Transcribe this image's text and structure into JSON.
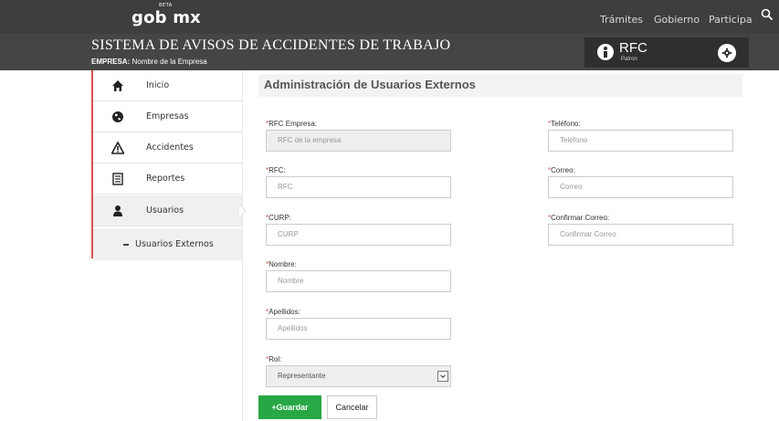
{
  "topbar": {
    "logo": "gob",
    "logo_mx": "mx",
    "beta": "BETA",
    "links": [
      "Trámites",
      "Gobierno",
      "Participa"
    ]
  },
  "header": {
    "title": "SISTEMA DE AVISOS DE ACCIDENTES DE TRABAJO",
    "company_label": "EMPRESA:",
    "company_value": "Nombre de la Empresa",
    "rfc_label": "RFC",
    "rfc_sub": "Patron"
  },
  "sidebar": {
    "items": [
      {
        "label": "Inicio",
        "icon": "home-icon"
      },
      {
        "label": "Empresas",
        "icon": "globe-icon"
      },
      {
        "label": "Accidentes",
        "icon": "warning-icon"
      },
      {
        "label": "Reportes",
        "icon": "report-icon"
      },
      {
        "label": "Usuarios",
        "icon": "user-icon"
      }
    ],
    "sub_item": "Usuarios Externos"
  },
  "main": {
    "title": "Administración de Usuarios Externos",
    "fields": {
      "rfc_empresa": {
        "label": "RFC Empresa:",
        "placeholder": "RFC de la  empresa"
      },
      "telefono": {
        "label": "Teléfono:",
        "placeholder": "Teléfono"
      },
      "rfc": {
        "label": "RFC:",
        "placeholder": "RFC"
      },
      "correo": {
        "label": "Correo:",
        "placeholder": "Correo"
      },
      "curp": {
        "label": "CURP:",
        "placeholder": "CURP"
      },
      "confirmar_correo": {
        "label": "Confirmar Correo:",
        "placeholder": "Confirmar Correo"
      },
      "nombre": {
        "label": "Nombre:",
        "placeholder": "Nombre"
      },
      "apellidos": {
        "label": "Apellidos:",
        "placeholder": "Apellidos"
      },
      "rol": {
        "label": "Rol:",
        "value": "Representante"
      }
    },
    "required_mark": "*",
    "save_label": "Guardar",
    "save_icon": "+",
    "cancel_label": "Cancelar"
  },
  "colors": {
    "accent_red": "#d9534f",
    "save_green": "#28a745",
    "topbar": "#3e3e3e"
  }
}
